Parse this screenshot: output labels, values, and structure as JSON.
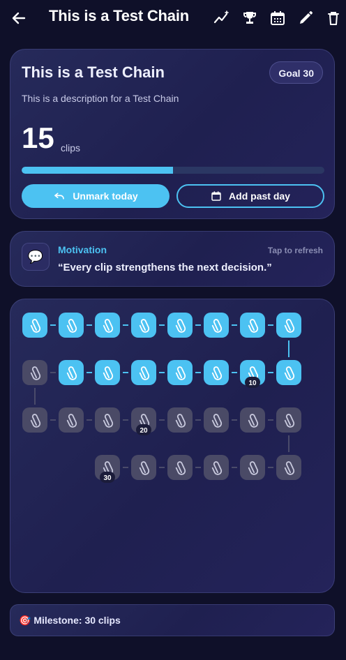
{
  "appbar": {
    "title": "This is a Test Chain",
    "icons": [
      "back-arrow-icon",
      "stats-trend-icon",
      "trophy-icon",
      "calendar-icon",
      "edit-pencil-icon",
      "delete-trash-icon"
    ]
  },
  "chain": {
    "title": "This is a Test Chain",
    "goal_label": "Goal 30",
    "description": "This is a description for a Test Chain",
    "count": "15",
    "count_unit": "clips",
    "progress": 0.5
  },
  "actions": {
    "unmark_label": "Unmark today",
    "add_past_label": "Add past day"
  },
  "motivation": {
    "label": "Motivation",
    "refresh_label": "Tap to refresh",
    "quote": "“Every clip strengthens the next decision.”",
    "icon": "speech-bubble-icon"
  },
  "clip_chain": {
    "total": 30,
    "completed": 15,
    "milestone_labels": [
      "10",
      "20",
      "30"
    ],
    "icon": "paperclip-icon"
  },
  "milestone": {
    "text": "🎯 Milestone: 30 clips"
  },
  "colors": {
    "accent": "#4cc2f2",
    "background": "#0f1029",
    "card": "#24255a",
    "clip_done": "#4cc2f2",
    "clip_pending": "#4a4a66"
  }
}
